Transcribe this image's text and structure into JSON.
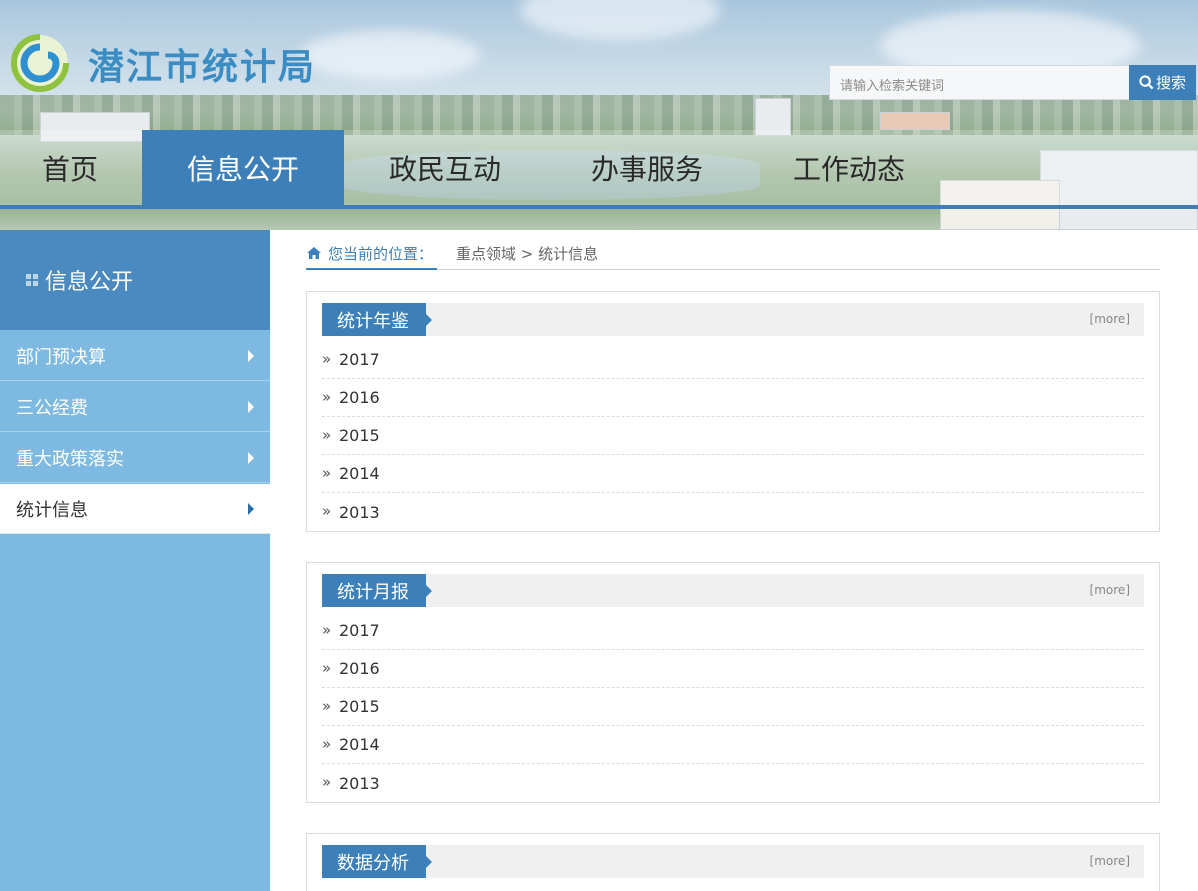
{
  "header": {
    "site_title": "潜江市统计局",
    "search_placeholder": "请输入检索关键词",
    "search_button": "搜索",
    "nav": [
      {
        "label": "首页",
        "active": false
      },
      {
        "label": "信息公开",
        "active": true
      },
      {
        "label": "政民互动",
        "active": false
      },
      {
        "label": "办事服务",
        "active": false
      },
      {
        "label": "工作动态",
        "active": false
      }
    ]
  },
  "sidebar": {
    "title": "信息公开",
    "items": [
      {
        "label": "部门预决算",
        "active": false
      },
      {
        "label": "三公经费",
        "active": false
      },
      {
        "label": "重大政策落实",
        "active": false
      },
      {
        "label": "统计信息",
        "active": true
      }
    ]
  },
  "breadcrumb": {
    "here_label": "您当前的位置：",
    "path": "重点领域 > 统计信息"
  },
  "panels": [
    {
      "title": "统计年鉴",
      "more": "[more]",
      "items": [
        "2017",
        "2016",
        "2015",
        "2014",
        "2013"
      ]
    },
    {
      "title": "统计月报",
      "more": "[more]",
      "items": [
        "2017",
        "2016",
        "2015",
        "2014",
        "2013"
      ]
    },
    {
      "title": "数据分析",
      "more": "[more]",
      "items": []
    }
  ],
  "colors": {
    "accent": "#3d80b9",
    "sidebar": "#7db9e0",
    "sidebar_head": "#4b8ac0",
    "title": "#3a8cc2"
  },
  "icons": [
    "logo-swirl-icon",
    "search-icon",
    "home-icon",
    "chevron-right-icon",
    "double-chevron-icon"
  ]
}
